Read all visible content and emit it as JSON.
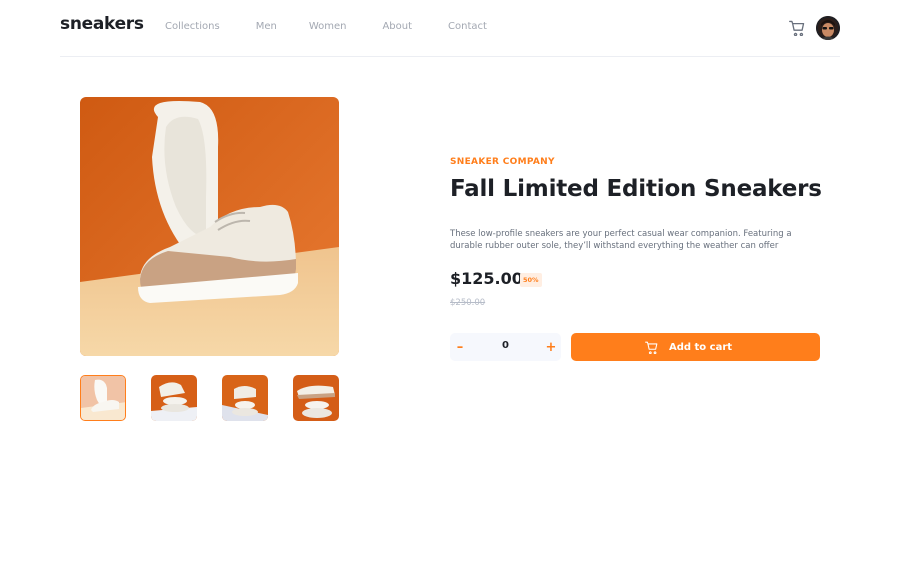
{
  "header": {
    "logo": "sneakers",
    "nav": [
      "Collections",
      "Men",
      "Women",
      "About",
      "Contact"
    ],
    "cart_icon": "cart-icon",
    "avatar_icon": "avatar"
  },
  "product": {
    "company": "SNEAKER COMPANY",
    "title": "Fall Limited Edition Sneakers",
    "description": "These low-profile sneakers are your perfect casual wear companion. Featuring a durable rubber outer sole, they’ll withstand everything the weather can offer",
    "price": "$125.00",
    "discount": "50%",
    "old_price": "$250.00",
    "quantity": "0",
    "minus_label": "–",
    "plus_label": "+",
    "add_to_cart_label": "Add to cart"
  },
  "gallery": {
    "thumbnails": [
      "thumbnail-1",
      "thumbnail-2",
      "thumbnail-3",
      "thumbnail-4"
    ],
    "active_thumbnail": "thumbnail-1"
  },
  "colors": {
    "accent": "#ff7e1b",
    "accent_light": "#ffeee2",
    "text_dark": "#1d2026",
    "text_muted": "#68707d",
    "nav_text": "#a3a8b2",
    "qty_bg": "#f6f8fd"
  }
}
